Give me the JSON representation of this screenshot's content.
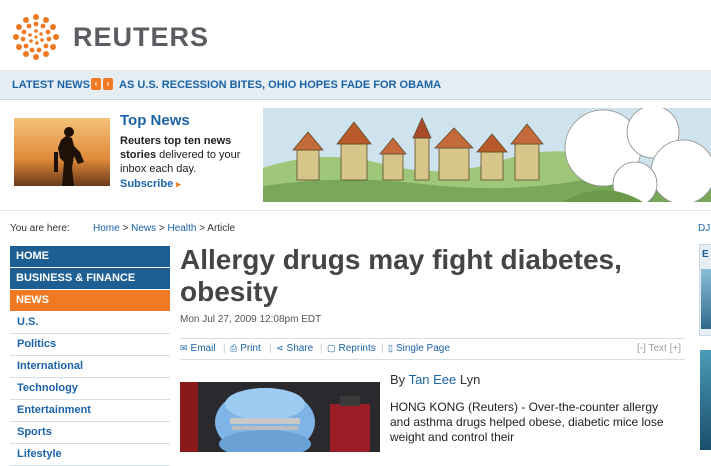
{
  "brand": {
    "name": "REUTERS",
    "accent": "#f07a23",
    "link": "#1a63a7",
    "nav_dark": "#1d5f93"
  },
  "ticker": {
    "label": "LATEST NEWS",
    "prev_icon": "chevron-left-icon",
    "next_icon": "chevron-right-icon",
    "headline": "AS U.S. RECESSION BITES, OHIO HOPES FADE FOR OBAMA"
  },
  "promo": {
    "title": "Top News",
    "desc_bold": "Reuters top ten news stories",
    "desc_rest": " delivered to your inbox each day.",
    "subscribe": "Subscribe"
  },
  "breadcrumb": {
    "label": "You are here:",
    "items": [
      "Home",
      "News",
      "Health",
      "Article"
    ],
    "sep": " > ",
    "right_stub": "DJ"
  },
  "nav": {
    "items": [
      {
        "label": "HOME",
        "style": "dark"
      },
      {
        "label": "BUSINESS & FINANCE",
        "style": "dark"
      },
      {
        "label": "NEWS",
        "style": "active"
      },
      {
        "label": "U.S.",
        "style": "sub"
      },
      {
        "label": "Politics",
        "style": "sub"
      },
      {
        "label": "International",
        "style": "sub"
      },
      {
        "label": "Technology",
        "style": "sub"
      },
      {
        "label": "Entertainment",
        "style": "sub"
      },
      {
        "label": "Sports",
        "style": "sub"
      },
      {
        "label": "Lifestyle",
        "style": "sub"
      }
    ]
  },
  "article": {
    "headline": "Allergy drugs may fight diabetes, obesity",
    "dateline": "Mon Jul 27, 2009 12:08pm EDT",
    "tools": {
      "email": "Email",
      "print": "Print",
      "share": "Share",
      "reprints": "Reprints",
      "single_page": "Single Page"
    },
    "text_size": {
      "minus": "[-]",
      "label": "Text",
      "plus": "[+]"
    },
    "byline_prefix": "By",
    "author_link": "Tan Eee",
    "author_rest": " Lyn",
    "body": "HONG KONG (Reuters) - Over-the-counter allergy and asthma drugs helped obese, diabetic mice lose weight and control their"
  },
  "right_rail": {
    "letter": "E"
  }
}
